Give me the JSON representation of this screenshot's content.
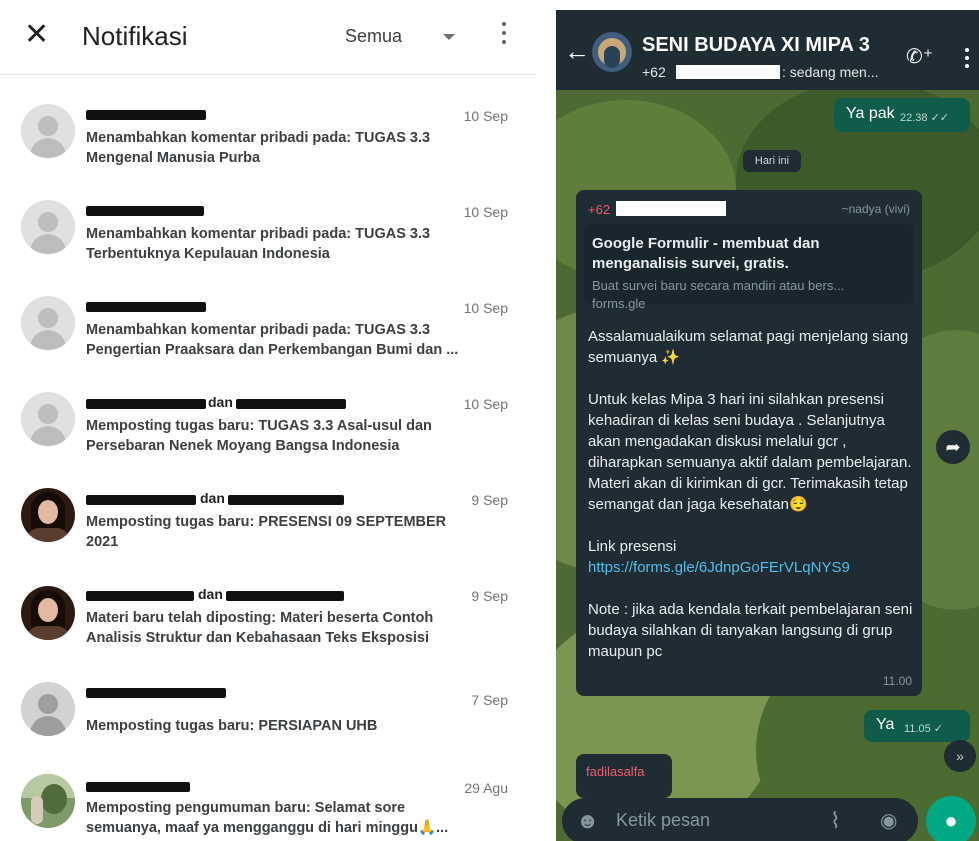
{
  "notifications_panel": {
    "title": "Notifikasi",
    "filter": "Semua",
    "items": [
      {
        "name_suffix": "",
        "date": "10 Sep",
        "text": "Menambahkan komentar pribadi pada: TUGAS 3.3 Mengenal Manusia Purba"
      },
      {
        "name_suffix": "",
        "date": "10 Sep",
        "text": "Menambahkan komentar pribadi pada: TUGAS 3.3 Terbentuknya Kepulauan Indonesia"
      },
      {
        "name_suffix": "",
        "date": "10 Sep",
        "text": "Menambahkan komentar pribadi pada: TUGAS 3.3 Pengertian Praaksara dan Perkembangan Bumi dan ..."
      },
      {
        "name_suffix": "dan",
        "date": "10 Sep",
        "text": "Memposting tugas baru: TUGAS 3.3 Asal-usul dan Persebaran Nenek Moyang Bangsa Indonesia"
      },
      {
        "name_suffix": "dan",
        "date": "9 Sep",
        "text": "Memposting tugas baru: PRESENSI 09 SEPTEMBER 2021"
      },
      {
        "name_suffix": "dan",
        "date": "9 Sep",
        "text": "Materi baru telah diposting: Materi beserta Contoh Analisis Struktur dan Kebahasaan Teks Eksposisi"
      },
      {
        "name_suffix": "",
        "date": "7 Sep",
        "text": "Memposting tugas baru: PERSIAPAN UHB"
      },
      {
        "name_suffix": "",
        "date": "29 Agu",
        "text": "Memposting pengumuman baru: Selamat sore semuanya, maaf ya mengganggu di hari minggu🙏..."
      }
    ]
  },
  "chat": {
    "group_name": "SENI BUDAYA  XI MIPA 3",
    "subtitle_prefix": "+62",
    "subtitle_suffix": ": sedang men...",
    "sent_1": {
      "text": "Ya pak",
      "time": "22.38 ✓✓"
    },
    "date_chip": "Hari ini",
    "main_message": {
      "sender_prefix": "+62",
      "alias": "~nadya (vivi)",
      "preview_title": "Google Formulir - membuat dan menganalisis survei, gratis.",
      "preview_desc": "Buat survei baru secara mandiri atau bers...",
      "preview_domain": "forms.gle",
      "para1": "Assalamualaikum selamat pagi menjelang siang semuanya ✨",
      "para2": "Untuk kelas Mipa 3 hari ini silahkan presensi kehadiran di kelas seni budaya . Selanjutnya akan mengadakan diskusi melalui gcr , diharapkan semuanya aktif dalam pembelajaran. Materi akan di kirimkan di gcr. Terimakasih tetap semangat dan jaga kesehatan😌",
      "link_label": "Link presensi",
      "link": "https://forms.gle/6JdnpGoFErVLqNYS9",
      "para3": "Note : jika ada kendala terkait pembelajaran seni budaya silahkan di tanyakan langsung di grup maupun pc",
      "time": "11.00"
    },
    "sent_2": {
      "text": "Ya",
      "time": "11.05 ✓"
    },
    "incoming_sender": "fadilasalfa",
    "input_placeholder": "Ketik pesan",
    "icons": [
      "back-arrow-icon",
      "add-call-icon",
      "more-icon",
      "forward-icon",
      "scroll-down-icon",
      "emoji-icon",
      "attach-icon",
      "camera-icon",
      "mic-icon"
    ]
  }
}
